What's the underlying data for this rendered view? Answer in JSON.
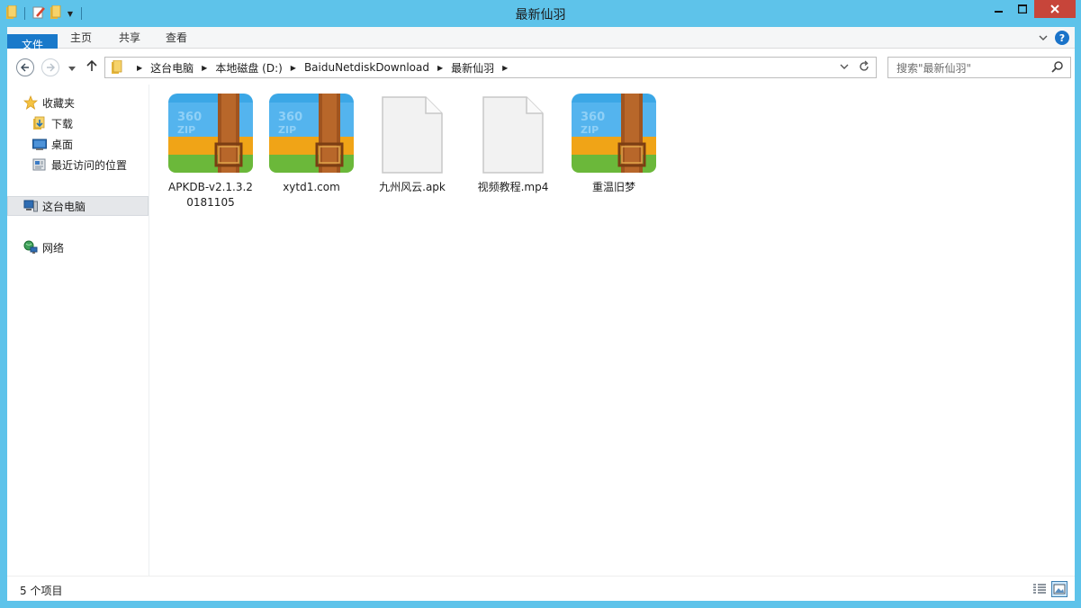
{
  "window": {
    "title": "最新仙羽"
  },
  "ribbon": {
    "tabs": [
      {
        "label": "文件"
      },
      {
        "label": "主页"
      },
      {
        "label": "共享"
      },
      {
        "label": "查看"
      }
    ]
  },
  "address": {
    "crumbs": [
      "这台电脑",
      "本地磁盘 (D:)",
      "BaiduNetdiskDownload",
      "最新仙羽"
    ]
  },
  "search": {
    "placeholder": "搜索\"最新仙羽\""
  },
  "nav": {
    "favorites": "收藏夹",
    "downloads": "下载",
    "desktop": "桌面",
    "recent": "最近访问的位置",
    "thispc": "这台电脑",
    "network": "网络"
  },
  "files": [
    {
      "name": "APKDB-v2.1.3.20181105",
      "icon": "zip-archive-icon"
    },
    {
      "name": "xytd1.com",
      "icon": "zip-archive-icon"
    },
    {
      "name": "九州风云.apk",
      "icon": "blank-file-icon"
    },
    {
      "name": "视频教程.mp4",
      "icon": "blank-file-icon"
    },
    {
      "name": "重温旧梦",
      "icon": "zip-archive-icon"
    }
  ],
  "status": {
    "count": "5 个项目"
  },
  "colors": {
    "accent": "#1979ca",
    "titlebar": "#5ec3ea",
    "close": "#c7453a"
  }
}
